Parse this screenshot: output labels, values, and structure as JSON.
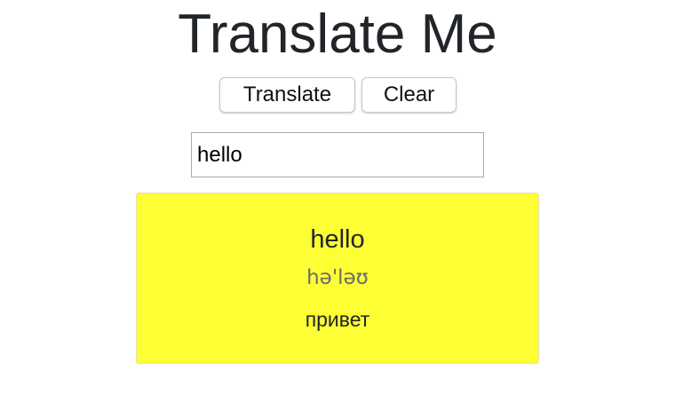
{
  "header": {
    "title": "Translate Me"
  },
  "toolbar": {
    "translate_label": "Translate",
    "clear_label": "Clear"
  },
  "search": {
    "value": "hello",
    "placeholder": ""
  },
  "result": {
    "word": "hello",
    "transcription": "hə'ləʊ",
    "translation": "привет"
  },
  "colors": {
    "card_background": "#fdfe33",
    "text": "#212529",
    "transcription": "#6c6c6c"
  }
}
